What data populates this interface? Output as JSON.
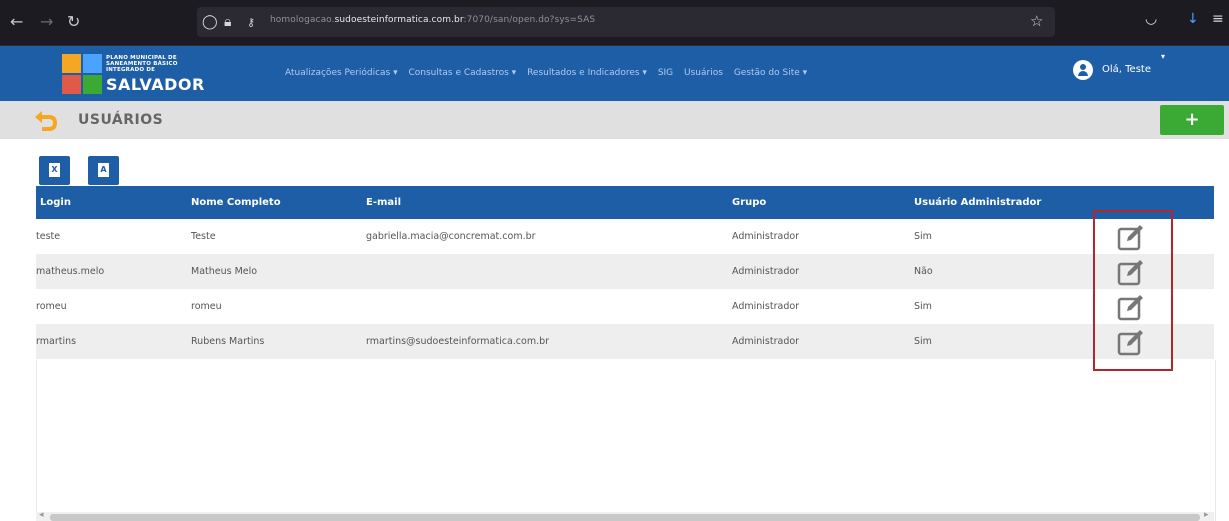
{
  "browser": {
    "url_prefix": "homologacao.",
    "url_domain": "sudoesteinformatica.com.br",
    "url_suffix": ":7070/san/open.do?sys=SAS"
  },
  "logo": {
    "line1": "PLANO MUNICIPAL DE",
    "line2": "SANEAMENTO BÁSICO",
    "line3": "INTEGRADO DE",
    "big": "SALVADOR"
  },
  "menu": [
    "Atualizações Periódicas ▾",
    "Consultas e Cadastros ▾",
    "Resultados e Indicadores ▾",
    "SIG",
    "Usuários",
    "Gestão do Site ▾"
  ],
  "user": {
    "greeting": "Olá, Teste"
  },
  "page": {
    "title": "USUÁRIOS",
    "add_label": "+"
  },
  "export": {
    "excel_label": "X",
    "pdf_label": "A"
  },
  "table": {
    "headers": [
      "Login",
      "Nome Completo",
      "E-mail",
      "Grupo",
      "Usuário Administrador"
    ],
    "rows": [
      {
        "login": "teste",
        "name": "Teste",
        "email": "gabriella.macia@concremat.com.br",
        "group": "Administrador",
        "admin": "Sim"
      },
      {
        "login": "matheus.melo",
        "name": "Matheus Melo",
        "email": "",
        "group": "Administrador",
        "admin": "Não"
      },
      {
        "login": "romeu",
        "name": "romeu",
        "email": "",
        "group": "Administrador",
        "admin": "Sim"
      },
      {
        "login": "rmartins",
        "name": "Rubens Martins",
        "email": "rmartins@sudoesteinformatica.com.br",
        "group": "Administrador",
        "admin": "Sim"
      }
    ]
  },
  "colors": {
    "brand_blue": "#1e5ea6",
    "add_green": "#3aaa35",
    "highlight_red": "#b3262b",
    "back_orange": "#f5a623"
  }
}
